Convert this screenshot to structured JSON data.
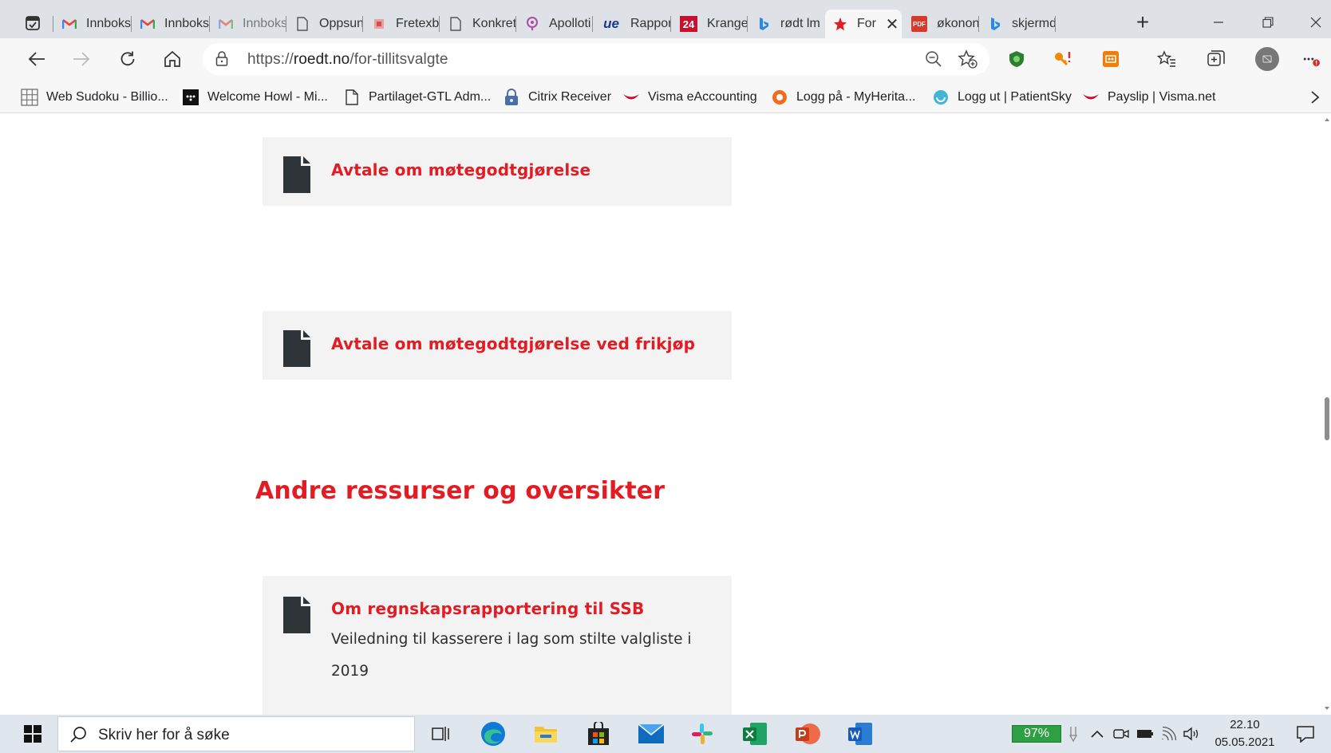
{
  "tabs": [
    {
      "title": "Innboks",
      "icon": "gmail-icon"
    },
    {
      "title": "Innboks",
      "icon": "gmail-icon"
    },
    {
      "title": "Innboks",
      "icon": "gmail-icon"
    },
    {
      "title": "Oppsun",
      "icon": "page-icon"
    },
    {
      "title": "Fretexb",
      "icon": "fretex-icon"
    },
    {
      "title": "Konkret",
      "icon": "page-icon"
    },
    {
      "title": "Apolloti",
      "icon": "location-icon"
    },
    {
      "title": "Rapport",
      "icon": "ue-icon",
      "badge": "ue"
    },
    {
      "title": "Krangel",
      "icon": "24-icon",
      "badge": "24"
    },
    {
      "title": "rødt lm",
      "icon": "bing-icon"
    },
    {
      "title": "For",
      "icon": "roedt-star-icon",
      "active": true
    },
    {
      "title": "økonon",
      "icon": "pdf-icon",
      "badge": "PDF"
    },
    {
      "title": "skjermd",
      "icon": "bing-icon"
    }
  ],
  "address": {
    "scheme": "https://",
    "host": "roedt.no",
    "path": "/for-tillitsvalgte"
  },
  "bookmarks": [
    {
      "label": "Web Sudoku - Billio...",
      "icon": "grid-icon"
    },
    {
      "label": "Welcome Howl - Mi...",
      "icon": "howl-icon"
    },
    {
      "label": "Partilaget-GTL Adm...",
      "icon": "page-icon"
    },
    {
      "label": "Citrix Receiver",
      "icon": "lock-icon"
    },
    {
      "label": "Visma eAccounting",
      "icon": "visma-icon"
    },
    {
      "label": "Logg på - MyHerita...",
      "icon": "myheritage-icon"
    },
    {
      "label": "Logg ut | PatientSky",
      "icon": "patientsky-icon"
    },
    {
      "label": "Payslip | Visma.net",
      "icon": "visma-icon"
    }
  ],
  "content": {
    "cards": [
      {
        "title": "Avtale om møtegodtgjørelse",
        "description": ""
      },
      {
        "title": "Avtale om møtegodtgjørelse ved frikjøp",
        "description": ""
      },
      {
        "title": "Om regnskapsrapportering til SSB",
        "description": "Veiledning til kasserere i lag som stilte valgliste i 2019"
      }
    ],
    "section_heading": "Andre ressurser og oversikter"
  },
  "taskbar": {
    "search_placeholder": "Skriv her for å søke",
    "apps": [
      "task-view-icon",
      "edge-icon",
      "file-explorer-icon",
      "store-icon",
      "mail-icon",
      "slack-icon",
      "excel-icon",
      "powerpoint-icon",
      "word-icon"
    ],
    "battery": "97%",
    "time": "22.10",
    "date": "05.05.2021"
  },
  "colors": {
    "accent_red": "#e31b23",
    "card_bg": "#f3f3f3",
    "doc_icon": "#2f3438"
  }
}
